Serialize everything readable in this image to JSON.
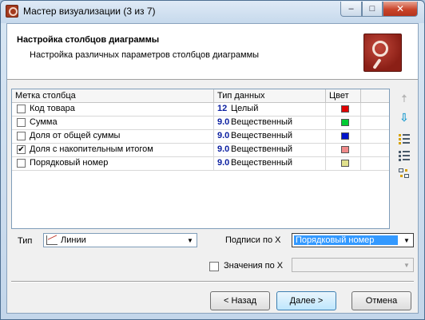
{
  "window": {
    "title": "Мастер визуализации (3 из 7)"
  },
  "header": {
    "title": "Настройка столбцов диаграммы",
    "subtitle": "Настройка различных параметров столбцов диаграммы"
  },
  "grid": {
    "columns": [
      "Метка столбца",
      "Тип данных",
      "Цвет"
    ],
    "rows": [
      {
        "label": "Код товара",
        "checked": false,
        "type_num": "12",
        "type": "Целый",
        "color": "#e00000"
      },
      {
        "label": "Сумма",
        "checked": false,
        "type_num": "9.0",
        "type": "Вещественный",
        "color": "#00cc33"
      },
      {
        "label": "Доля от общей суммы",
        "checked": false,
        "type_num": "9.0",
        "type": "Вещественный",
        "color": "#0014cc"
      },
      {
        "label": "Доля с накопительным итогом",
        "checked": true,
        "type_num": "9.0",
        "type": "Вещественный",
        "color": "#f08a8a"
      },
      {
        "label": "Порядковый номер",
        "checked": false,
        "type_num": "9.0",
        "type": "Вещественный",
        "color": "#e0e08c"
      }
    ]
  },
  "side_tools": [
    "arrow-up-icon",
    "arrow-down-icon",
    "check-all-icon",
    "uncheck-all-icon",
    "swap-icon"
  ],
  "controls": {
    "type_label": "Тип",
    "type_value": "Линии",
    "labels_x_label": "Подписи по X",
    "labels_x_value": "Порядковый номер",
    "values_x_label": "Значения по X",
    "values_x_checked": false
  },
  "buttons": {
    "back": "< Назад",
    "next": "Далее >",
    "cancel": "Отмена"
  },
  "title_buttons": {
    "minimize": "–",
    "maximize": "□",
    "close": "✕"
  }
}
